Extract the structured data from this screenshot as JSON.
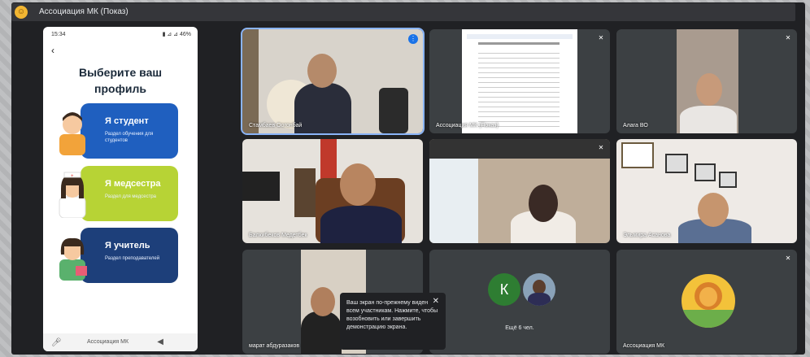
{
  "window": {
    "title": "Ассоциация МК (Показ)"
  },
  "phone": {
    "time": "15:34",
    "status_right": "▮ ⊿ ⊿ 46%",
    "heading_line1": "Выберите ваш",
    "heading_line2": "профиль",
    "cards": [
      {
        "title": "Я студент",
        "subtitle": "Раздел обучения для студентов",
        "color": "#1f5fbf"
      },
      {
        "title": "Я медсестра",
        "subtitle": "Раздел для медсестра",
        "color": "#b7d335"
      },
      {
        "title": "Я учитель",
        "subtitle": "Раздел преподавателей",
        "color": "#1d3f7a"
      }
    ],
    "navbar_text": "Ассоциация МК"
  },
  "tiles": [
    {
      "name": "Стамбаев Оогонбай"
    },
    {
      "name": "Ассоциация МК (Показ)"
    },
    {
      "name": "Алага ВО"
    },
    {
      "name": "Балкибеков Медетбек"
    },
    {
      "name": ""
    },
    {
      "name": "Эльмира Асанова"
    },
    {
      "name": "марат абдуразаков"
    },
    {
      "name": "Ещё 6 чел."
    },
    {
      "name": "Ассоциация МК"
    }
  ],
  "toast": {
    "text": "Ваш экран по-прежнему виден всем участникам. Нажмите, чтобы возобновить или завершить демонстрацию экрана.",
    "close": "✕"
  },
  "avatar_letter": "К",
  "colors": {
    "accent": "#1a73e8",
    "meet_bg": "#202124"
  }
}
